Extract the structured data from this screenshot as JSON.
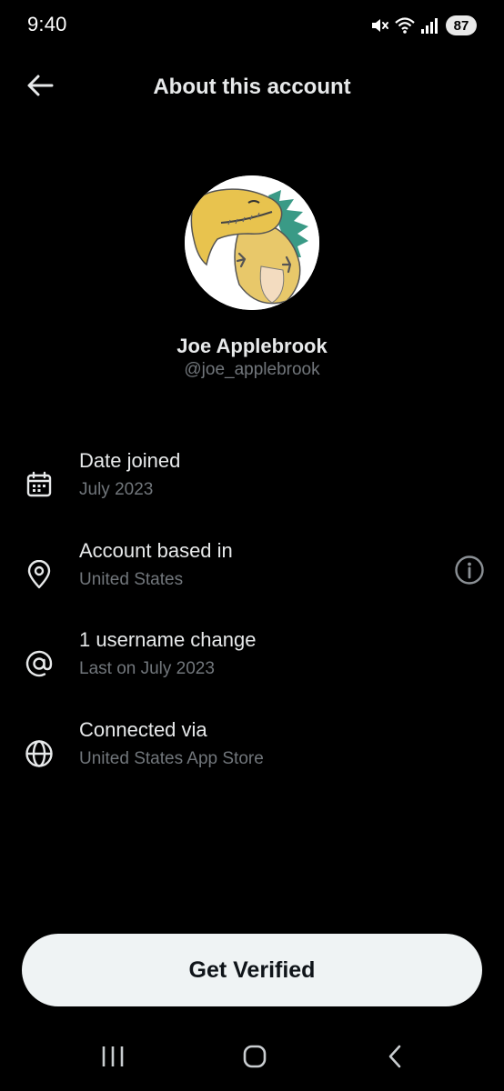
{
  "status_bar": {
    "time": "9:40",
    "battery": "87",
    "icons": [
      "mute-icon",
      "wifi-icon",
      "signal-icon",
      "battery-icon"
    ]
  },
  "header": {
    "title": "About this account",
    "back_icon": "back-arrow-icon"
  },
  "profile": {
    "name": "Joe Applebrook",
    "handle": "@joe_applebrook"
  },
  "info_rows": [
    {
      "icon": "calendar-icon",
      "title": "Date joined",
      "subtitle": "July 2023"
    },
    {
      "icon": "location-pin-icon",
      "title": "Account based in",
      "subtitle": "United States",
      "action_icon": "info-icon"
    },
    {
      "icon": "at-sign-icon",
      "title": "1 username change",
      "subtitle": "Last on July 2023"
    },
    {
      "icon": "globe-icon",
      "title": "Connected via",
      "subtitle": "United States App Store"
    }
  ],
  "cta": {
    "label": "Get Verified"
  },
  "system_nav": {
    "icons": [
      "recent-apps-icon",
      "home-icon",
      "back-icon"
    ]
  },
  "colors": {
    "background": "#000000",
    "text_primary": "#e7e9ea",
    "text_secondary": "#71767b",
    "button_bg": "#eff3f4",
    "button_text": "#0f1419"
  }
}
